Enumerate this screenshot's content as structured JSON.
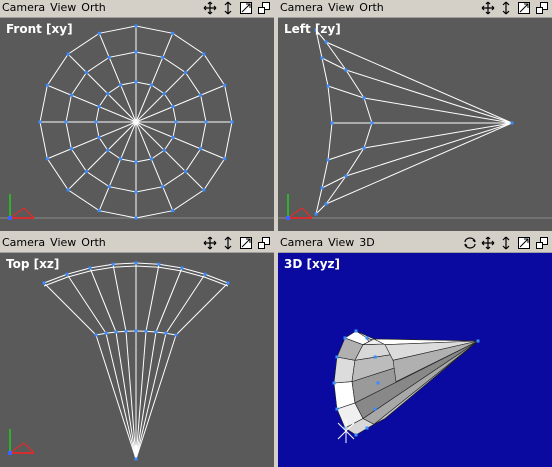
{
  "viewports": {
    "front": {
      "menu": {
        "camera": "Camera",
        "view": "View",
        "projection": "Orth"
      },
      "label": "Front [xy]",
      "tools": [
        "move-icon",
        "pan-vertical-icon",
        "maximize-icon",
        "restore-icon"
      ]
    },
    "left": {
      "menu": {
        "camera": "Camera",
        "view": "View",
        "projection": "Orth"
      },
      "label": "Left [zy]",
      "tools": [
        "move-icon",
        "pan-vertical-icon",
        "maximize-icon",
        "restore-icon"
      ]
    },
    "top": {
      "menu": {
        "camera": "Camera",
        "view": "View",
        "projection": "Orth"
      },
      "label": "Top [xz]",
      "tools": [
        "move-icon",
        "pan-vertical-icon",
        "maximize-icon",
        "restore-icon"
      ]
    },
    "persp": {
      "menu": {
        "camera": "Camera",
        "view": "View",
        "projection": "3D"
      },
      "label": "3D [xyz]",
      "tools": [
        "rotate-icon",
        "move-icon",
        "pan-vertical-icon",
        "maximize-icon",
        "restore-icon"
      ]
    }
  },
  "colors": {
    "ortho_bg": "#5a5a5a",
    "persp_bg": "#0a0aa0",
    "wire": "#ffffff",
    "vertex": "#3a8cff",
    "axis_x": "#ff2020",
    "axis_y": "#20d020",
    "axis_z": "#4060ff"
  }
}
